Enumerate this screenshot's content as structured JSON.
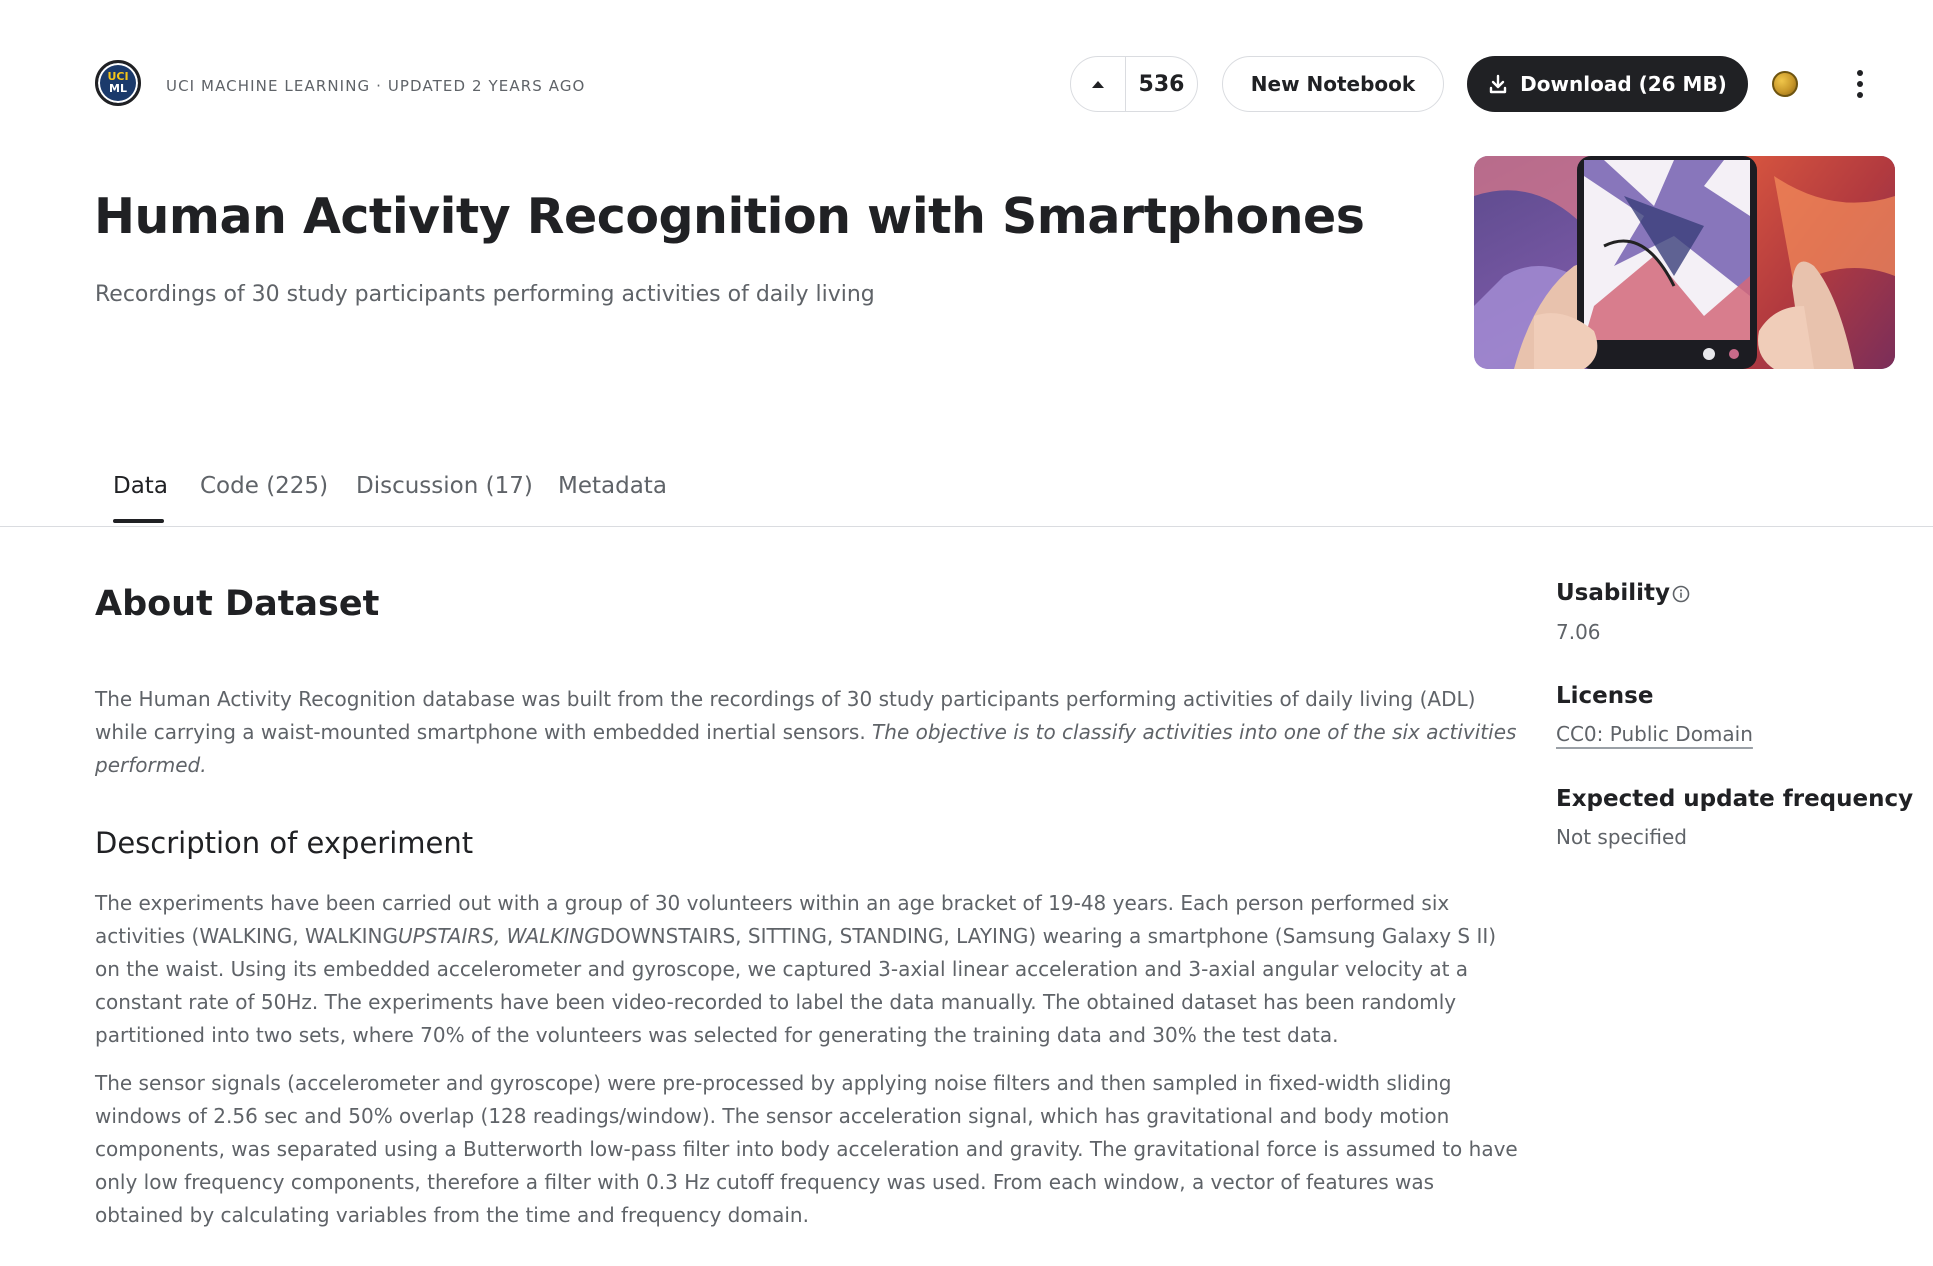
{
  "header": {
    "org_logo": {
      "line1": "UCI",
      "line2": "ML"
    },
    "owner_line": "UCI Machine Learning · Updated 2 years ago",
    "vote_count": "536",
    "new_notebook_label": "New Notebook",
    "download_label": "Download (26 MB)"
  },
  "dataset": {
    "title": "Human Activity Recognition with Smartphones",
    "subtitle": "Recordings of 30 study participants performing activities of daily living"
  },
  "tabs": [
    {
      "label": "Data",
      "active": true
    },
    {
      "label": "Code (225)",
      "active": false
    },
    {
      "label": "Discussion (17)",
      "active": false
    },
    {
      "label": "Metadata",
      "active": false
    }
  ],
  "about": {
    "heading": "About Dataset",
    "p1_plain": "The Human Activity Recognition database was built from the recordings of 30 study participants performing activities of daily living (ADL) while carrying a waist-mounted smartphone with embedded inertial sensors. ",
    "p1_italic": "The objective is to classify activities into one of the six activities performed.",
    "desc_heading": "Description of experiment",
    "p2_a": "The experiments have been carried out with a group of 30 volunteers within an age bracket of 19-48 years. Each person performed six activities (WALKING, WALKING",
    "p2_italic": "UPSTAIRS, WALKING",
    "p2_b": "DOWNSTAIRS, SITTING, STANDING, LAYING) wearing a smartphone (Samsung Galaxy S II) on the waist. Using its embedded accelerometer and gyroscope, we captured 3-axial linear acceleration and 3-axial angular velocity at a constant rate of 50Hz. The experiments have been video-recorded to label the data manually. The obtained dataset has been randomly partitioned into two sets, where 70% of the volunteers was selected for generating the training data and 30% the test data.",
    "p3": "The sensor signals (accelerometer and gyroscope) were pre-processed by applying noise filters and then sampled in fixed-width sliding windows of 2.56 sec and 50% overlap (128 readings/window). The sensor acceleration signal, which has gravitational and body motion components, was separated using a Butterworth low-pass filter into body acceleration and gravity. The gravitational force is assumed to have only low frequency components, therefore a filter with 0.3 Hz cutoff frequency was used. From each window, a vector of features was obtained by calculating variables from the time and frequency domain."
  },
  "sidebar": {
    "usability_label": "Usability",
    "usability_value": "7.06",
    "license_label": "License",
    "license_value": "CC0: Public Domain",
    "update_label": "Expected update frequency",
    "update_value": "Not specified"
  },
  "icons": {
    "upvote": "caret-up-icon",
    "download": "download-icon",
    "medal": "medal-icon",
    "more": "kebab-menu-icon",
    "info": "info-icon"
  },
  "colors": {
    "primary_dark": "#202124",
    "secondary_text": "#5f6368",
    "border": "#dadce0"
  }
}
